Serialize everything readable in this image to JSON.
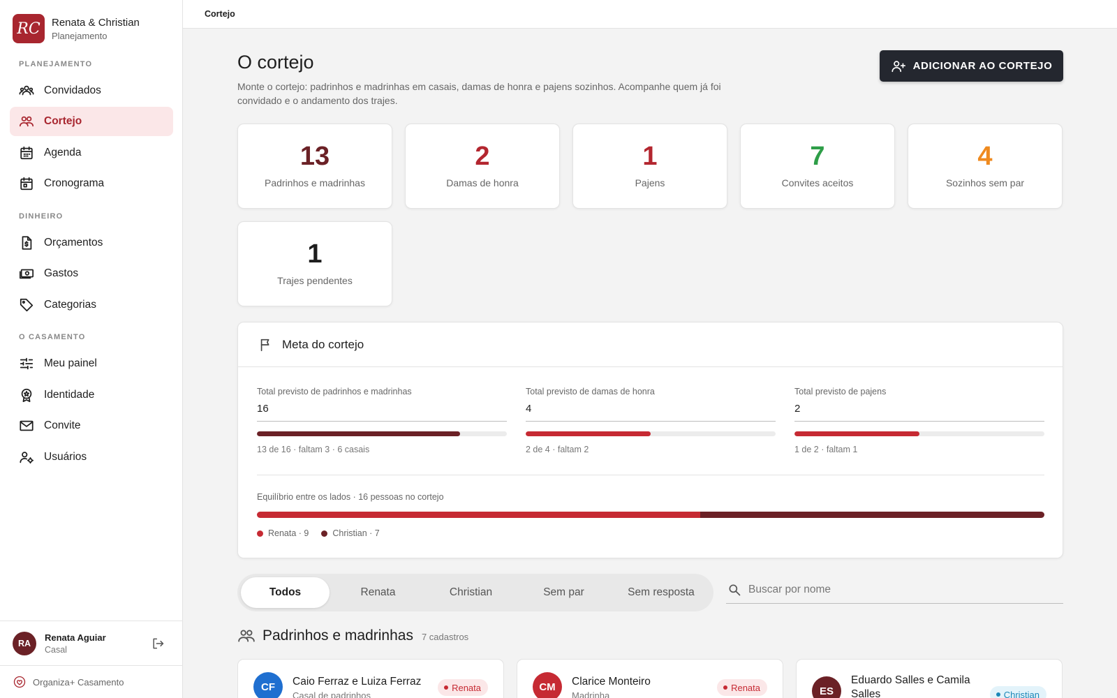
{
  "brand": {
    "initials": "RC",
    "title": "Renata & Christian",
    "subtitle": "Planejamento"
  },
  "sidebar": {
    "sections": [
      {
        "label": "PLANEJAMENTO",
        "items": [
          "Convidados",
          "Cortejo",
          "Agenda",
          "Cronograma"
        ]
      },
      {
        "label": "DINHEIRO",
        "items": [
          "Orçamentos",
          "Gastos",
          "Categorias"
        ]
      },
      {
        "label": "O CASAMENTO",
        "items": [
          "Meu painel",
          "Identidade",
          "Convite",
          "Usuários"
        ]
      }
    ],
    "active": "Cortejo",
    "icons": [
      "people-icon",
      "cortejo-icon",
      "calendar-icon",
      "schedule-icon",
      "budget-icon",
      "cash-icon",
      "tag-icon",
      "sliders-icon",
      "badge-icon",
      "mail-icon",
      "user-settings-icon"
    ]
  },
  "user": {
    "initials": "RA",
    "name": "Renata Aguiar",
    "role": "Casal"
  },
  "footer": {
    "label": "Organiza+ Casamento"
  },
  "topbar": {
    "breadcrumb": "Cortejo"
  },
  "page": {
    "title": "O cortejo",
    "description": "Monte o cortejo: padrinhos e madrinhas em casais, damas de honra e pajens sozinhos. Acompanhe quem já foi convidado e o andamento dos trajes.",
    "add_button": "ADICIONAR AO CORTEJO"
  },
  "stats": [
    {
      "value": "13",
      "label": "Padrinhos e madrinhas",
      "color": "#6b2126"
    },
    {
      "value": "2",
      "label": "Damas de honra",
      "color": "#b3262f"
    },
    {
      "value": "1",
      "label": "Pajens",
      "color": "#b3262f"
    },
    {
      "value": "7",
      "label": "Convites aceitos",
      "color": "#2e9e48"
    },
    {
      "value": "4",
      "label": "Sozinhos sem par",
      "color": "#ef8a1f"
    },
    {
      "value": "1",
      "label": "Trajes pendentes",
      "color": "#1e1e1e"
    }
  ],
  "meta": {
    "title": "Meta do cortejo",
    "goals": [
      {
        "label": "Total previsto de padrinhos e madrinhas",
        "value": "16",
        "progress": 0.8125,
        "note": "13 de 16 · faltam 3 · 6 casais",
        "color": "#6b2126"
      },
      {
        "label": "Total previsto de damas de honra",
        "value": "4",
        "progress": 0.5,
        "note": "2 de 4 · faltam 2",
        "color": "#c62a33"
      },
      {
        "label": "Total previsto de pajens",
        "value": "2",
        "progress": 0.5,
        "note": "1 de 2 · faltam 1",
        "color": "#c62a33"
      }
    ],
    "balance": {
      "label": "Equilíbrio entre os lados · 16 pessoas no cortejo",
      "sides": [
        {
          "name": "Renata · 9",
          "count": 9,
          "color": "#c62a33"
        },
        {
          "name": "Christian · 7",
          "count": 7,
          "color": "#6b2126"
        }
      ]
    }
  },
  "filters": {
    "tabs": [
      "Todos",
      "Renata",
      "Christian",
      "Sem par",
      "Sem resposta"
    ],
    "active": "Todos"
  },
  "search": {
    "placeholder": "Buscar por nome",
    "value": ""
  },
  "section": {
    "title": "Padrinhos e madrinhas",
    "count": "7 cadastros"
  },
  "people": [
    {
      "initials": "CF",
      "name": "Caio Ferraz e Luiza Ferraz",
      "subtitle": "Casal de padrinhos",
      "side": "Renata",
      "avatar_color": "#1f6fd0",
      "chip_color": "#c62a33",
      "chip_bg": "#fbe7e8"
    },
    {
      "initials": "CM",
      "name": "Clarice Monteiro",
      "subtitle": "Madrinha",
      "side": "Renata",
      "avatar_color": "#c62a33",
      "chip_color": "#c62a33",
      "chip_bg": "#fbe7e8"
    },
    {
      "initials": "ES",
      "name": "Eduardo Salles e Camila Salles",
      "subtitle": "",
      "side": "Christian",
      "avatar_color": "#6b2126",
      "chip_color": "#1b87b8",
      "chip_bg": "#e3f3fa"
    }
  ]
}
